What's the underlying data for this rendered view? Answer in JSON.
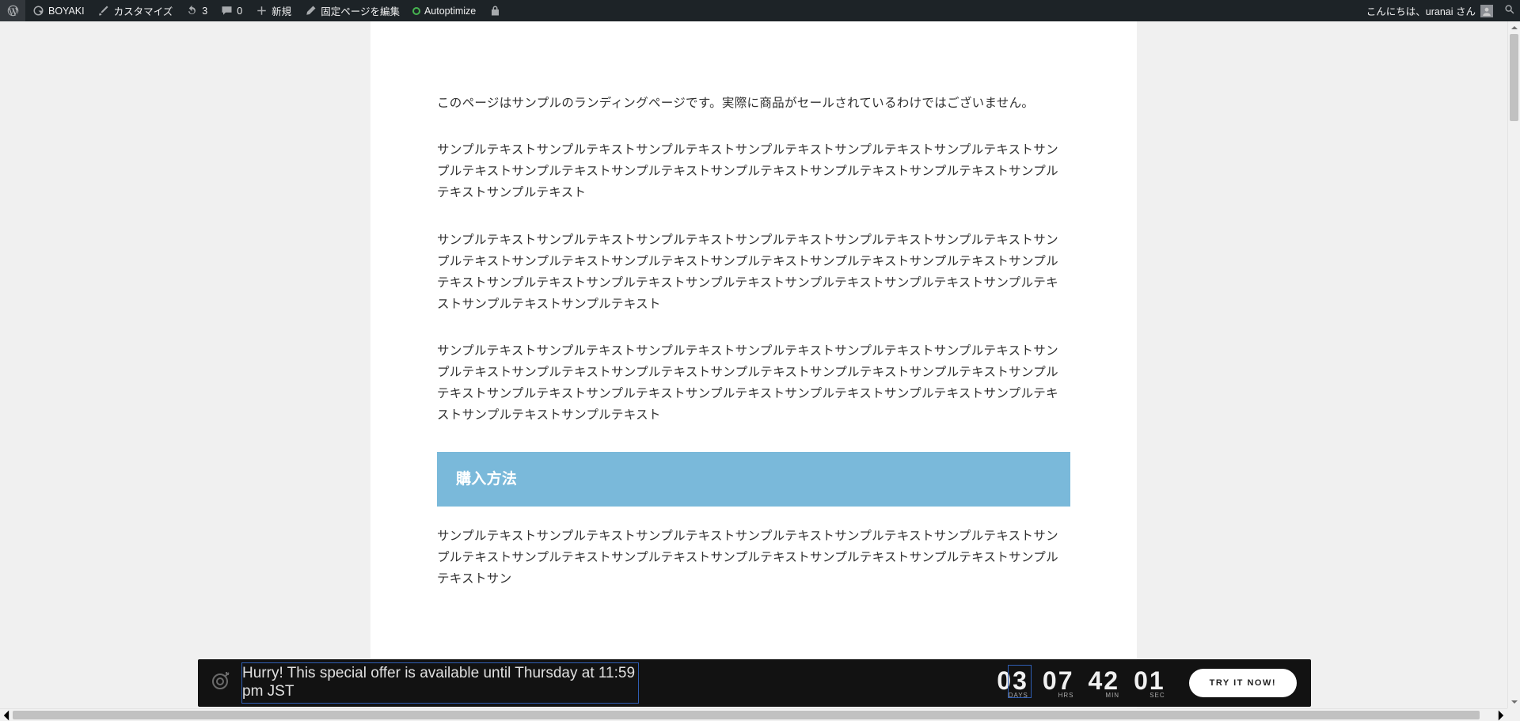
{
  "adminbar": {
    "site_name": "BOYAKI",
    "customize": "カスタマイズ",
    "updates_count": "3",
    "comments_count": "0",
    "new_label": "新規",
    "edit_page": "固定ページを編集",
    "autoptimize": "Autoptimize",
    "greeting": "こんにちは、uranai さん"
  },
  "content": {
    "intro": "このページはサンプルのランディングページです。実際に商品がセールされているわけではございません。",
    "p1": "サンプルテキストサンプルテキストサンプルテキストサンプルテキストサンプルテキストサンプルテキストサンプルテキストサンプルテキストサンプルテキストサンプルテキストサンプルテキストサンプルテキストサンプルテキストサンプルテキスト",
    "p2": "サンプルテキストサンプルテキストサンプルテキストサンプルテキストサンプルテキストサンプルテキストサンプルテキストサンプルテキストサンプルテキストサンプルテキストサンプルテキストサンプルテキストサンプルテキストサンプルテキストサンプルテキストサンプルテキストサンプルテキストサンプルテキストサンプルテキストサンプルテキストサンプルテキスト",
    "p3": "サンプルテキストサンプルテキストサンプルテキストサンプルテキストサンプルテキストサンプルテキストサンプルテキストサンプルテキストサンプルテキストサンプルテキストサンプルテキストサンプルテキストサンプルテキストサンプルテキストサンプルテキストサンプルテキストサンプルテキストサンプルテキストサンプルテキストサンプルテキストサンプルテキスト",
    "heading1": "購入方法",
    "p4": "サンプルテキストサンプルテキストサンプルテキストサンプルテキストサンプルテキストサンプルテキストサンプルテキストサンプルテキストサンプルテキストサンプルテキストサンプルテキストサンプルテキストサンプルテキストサン"
  },
  "countdown": {
    "message_l1": "Hurry! This special offer is available until Thursday at 11:59",
    "message_l2": "pm JST",
    "days_val": "03",
    "days_label": "DAYS",
    "hrs_val": "07",
    "hrs_label": "HRS",
    "min_val": "42",
    "min_label": "MIN",
    "sec_val": "01",
    "sec_label": "SEC",
    "cta": "TRY IT NOW!"
  }
}
